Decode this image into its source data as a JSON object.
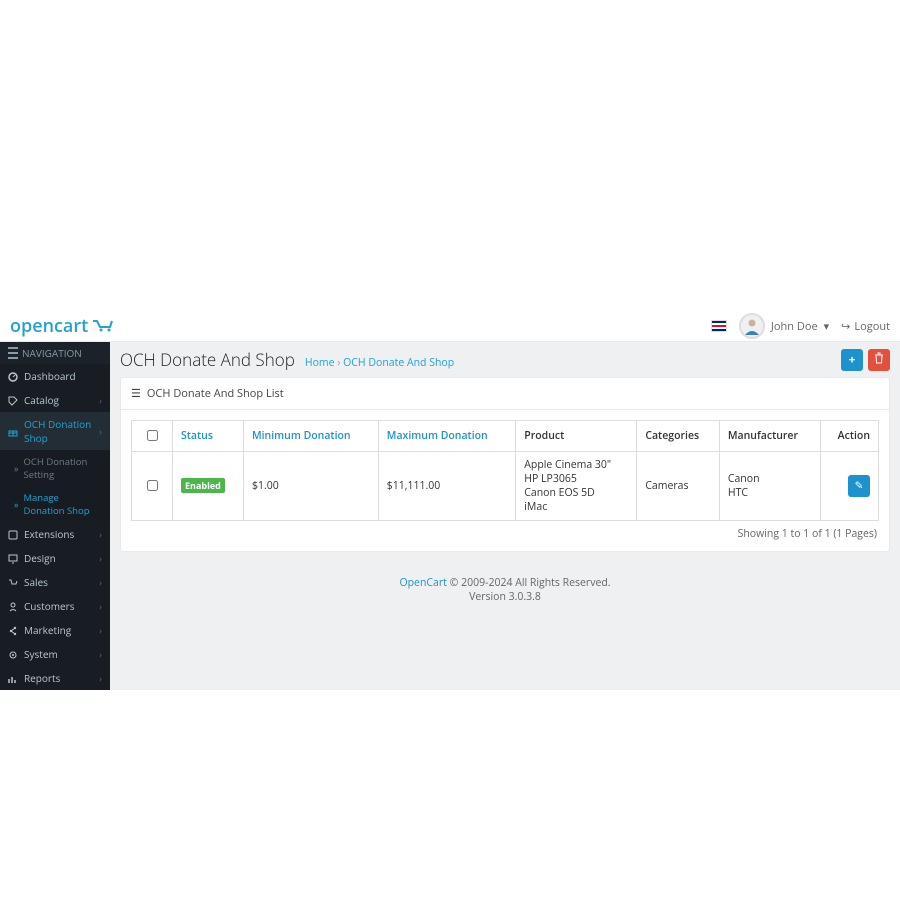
{
  "logo": {
    "text": "opencart"
  },
  "header": {
    "user_name": "John Doe",
    "logout_label": "Logout"
  },
  "sidebar": {
    "title": "NAVIGATION",
    "items": [
      {
        "icon": "dashboard",
        "label": "Dashboard",
        "has_children": false
      },
      {
        "icon": "tag",
        "label": "Catalog",
        "has_children": true
      },
      {
        "icon": "gift",
        "label": "OCH Donation Shop",
        "has_children": true,
        "active": true
      },
      {
        "icon": "puzzle",
        "label": "Extensions",
        "has_children": true
      },
      {
        "icon": "monitor",
        "label": "Design",
        "has_children": true
      },
      {
        "icon": "cart",
        "label": "Sales",
        "has_children": true
      },
      {
        "icon": "user",
        "label": "Customers",
        "has_children": true
      },
      {
        "icon": "share",
        "label": "Marketing",
        "has_children": true
      },
      {
        "icon": "gear",
        "label": "System",
        "has_children": true
      },
      {
        "icon": "chart",
        "label": "Reports",
        "has_children": true
      }
    ],
    "sub": [
      {
        "label": "OCH Donation Setting"
      },
      {
        "label": "Manage Donation Shop",
        "active": true
      }
    ]
  },
  "page": {
    "title": "OCH Donate And Shop",
    "breadcrumb_home": "Home",
    "breadcrumb_sep": "›",
    "breadcrumb_current": "OCH Donate And Shop",
    "panel_title": "OCH Donate And Shop List"
  },
  "table": {
    "headers": {
      "status": "Status",
      "min": "Minimum Donation",
      "max": "Maximum Donation",
      "product": "Product",
      "categories": "Categories",
      "manufacturer": "Manufacturer",
      "action": "Action"
    },
    "row": {
      "status": "Enabled",
      "min": "$1.00",
      "max": "$11,111.00",
      "products": [
        "Apple Cinema 30\"",
        "HP LP3065",
        "Canon EOS 5D",
        "iMac"
      ],
      "categories": "Cameras",
      "manufacturers": [
        "Canon",
        "HTC"
      ]
    },
    "pager": "Showing 1 to 1 of 1 (1 Pages)"
  },
  "footer": {
    "link": "OpenCart",
    "copy": " © 2009-2024 All Rights Reserved.",
    "version": "Version 3.0.3.8"
  },
  "icons": {
    "plus": "+",
    "trash": "🗑",
    "pencil": "✎",
    "list": "☰",
    "caret": "▾",
    "raquo": "»",
    "chev": "›",
    "signout": "↪"
  }
}
